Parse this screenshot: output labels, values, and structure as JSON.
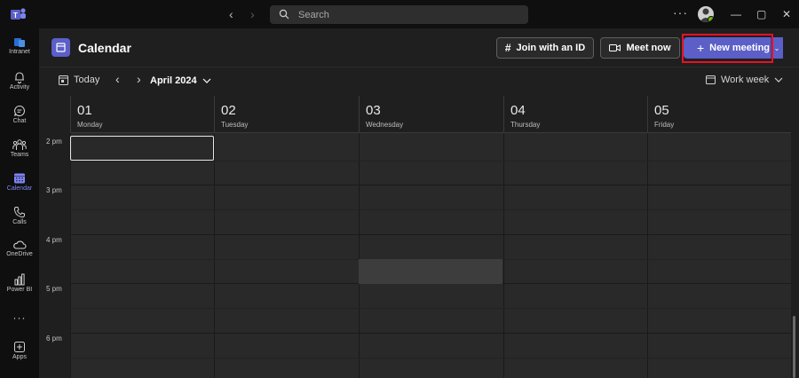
{
  "titlebar": {
    "search_placeholder": "Search",
    "more_label": "···"
  },
  "rail": {
    "items": [
      {
        "label": "Intranet",
        "icon": "intranet-icon"
      },
      {
        "label": "Activity",
        "icon": "bell-icon"
      },
      {
        "label": "Chat",
        "icon": "chat-icon"
      },
      {
        "label": "Teams",
        "icon": "teams-icon"
      },
      {
        "label": "Calendar",
        "icon": "calendar-icon",
        "active": true
      },
      {
        "label": "Calls",
        "icon": "phone-icon"
      },
      {
        "label": "OneDrive",
        "icon": "cloud-icon"
      },
      {
        "label": "Power BI",
        "icon": "chart-icon"
      },
      {
        "label": "···",
        "icon": "more-icon"
      },
      {
        "label": "Apps",
        "icon": "add-app-icon"
      }
    ],
    "active_color": "#7f85f5"
  },
  "header": {
    "title": "Calendar",
    "join_label": "Join with an ID",
    "meet_label": "Meet now",
    "new_label": "New meeting",
    "accent": "#5b5fc7"
  },
  "toolbar": {
    "today_label": "Today",
    "month_label": "April 2024",
    "view_label": "Work week"
  },
  "calendar": {
    "days": [
      {
        "num": "01",
        "name": "Monday"
      },
      {
        "num": "02",
        "name": "Tuesday"
      },
      {
        "num": "03",
        "name": "Wednesday"
      },
      {
        "num": "04",
        "name": "Thursday"
      },
      {
        "num": "05",
        "name": "Friday"
      }
    ],
    "times": [
      "2 pm",
      "3 pm",
      "4 pm",
      "5 pm",
      "6 pm"
    ]
  },
  "annotation": {
    "highlight_color": "#e81123"
  }
}
